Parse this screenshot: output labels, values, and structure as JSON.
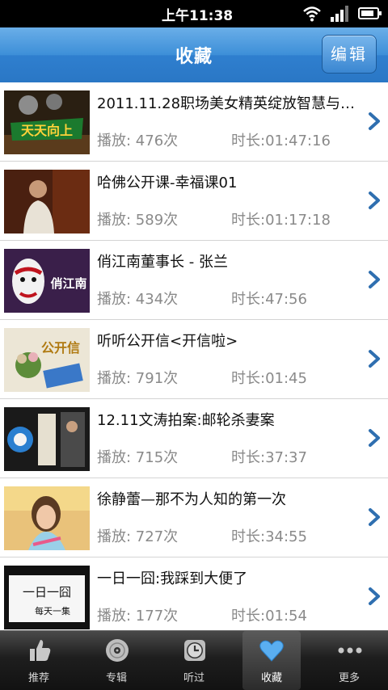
{
  "status": {
    "time": "上午11:38",
    "battery_level": 0.85
  },
  "header": {
    "title": "收藏",
    "edit_label": "编辑"
  },
  "items": [
    {
      "title": "2011.11.28职场美女精英绽放智慧与…",
      "plays": "播放: 476次",
      "duration": "时长:01:47:16",
      "thumb_text": "天天向上"
    },
    {
      "title": "哈佛公开课-幸福课01",
      "plays": "播放: 589次",
      "duration": "时长:01:17:18"
    },
    {
      "title": "俏江南董事长 - 张兰",
      "plays": "播放: 434次",
      "duration": "时长:47:56",
      "thumb_text": "俏江南"
    },
    {
      "title": "听听公开信<开信啦>",
      "plays": "播放: 791次",
      "duration": "时长:01:45",
      "thumb_text": "公开信"
    },
    {
      "title": "12.11文涛拍案:邮轮杀妻案",
      "plays": "播放: 715次",
      "duration": "时长:37:37"
    },
    {
      "title": "徐静蕾—那不为人知的第一次",
      "plays": "播放: 727次",
      "duration": "时长:34:55"
    },
    {
      "title": "一日一囧:我踩到大便了",
      "plays": "播放: 177次",
      "duration": "时长:01:54",
      "thumb_text": "一日一囧",
      "thumb_sub": "每天一集"
    }
  ],
  "tabs": [
    {
      "label": "推荐",
      "icon": "thumbs-up-icon"
    },
    {
      "label": "专辑",
      "icon": "disc-icon"
    },
    {
      "label": "听过",
      "icon": "clock-icon"
    },
    {
      "label": "收藏",
      "icon": "heart-icon",
      "active": true
    },
    {
      "label": "更多",
      "icon": "more-icon"
    }
  ],
  "colors": {
    "header_blue": "#3d8fd8",
    "chevron_blue": "#2f6fb0",
    "meta_gray": "#8a8a8a"
  }
}
